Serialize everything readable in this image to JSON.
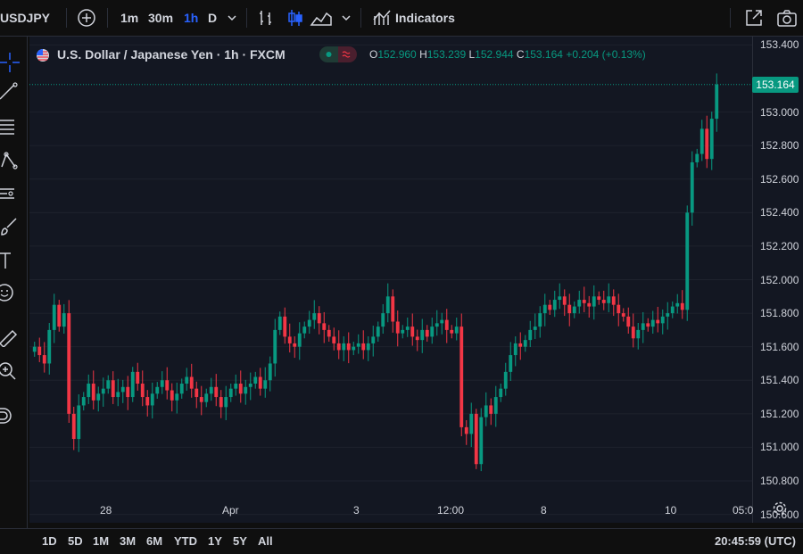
{
  "toolbar": {
    "symbol": "USDJPY",
    "intervals": [
      "1m",
      "30m",
      "1h",
      "D"
    ],
    "active_interval": "1h",
    "indicators_label": "Indicators",
    "icons": [
      "add-symbol-icon",
      "chevron-down-icon",
      "bar-replay-icon",
      "candles-icon",
      "area-chart-icon",
      "indicators-icon",
      "fullscreen-icon",
      "camera-icon"
    ]
  },
  "legend": {
    "title": "U.S. Dollar / Japanese Yen · 1h · FXCM",
    "o_label": "O",
    "o": "152.960",
    "h_label": "H",
    "h": "153.239",
    "l_label": "L",
    "l": "152.944",
    "c_label": "C",
    "c": "153.164",
    "change": "+0.204 (+0.13%)"
  },
  "price_axis": {
    "ticks": [
      "153.400",
      "153.000",
      "152.800",
      "152.600",
      "152.400",
      "152.200",
      "152.000",
      "151.800",
      "151.600",
      "151.400",
      "151.200",
      "151.000",
      "150.800",
      "150.600"
    ],
    "current_price": "153.164"
  },
  "time_axis": {
    "ticks": [
      "28",
      "Apr",
      "3",
      "12:00",
      "8",
      "10",
      "05:0"
    ]
  },
  "bottom": {
    "ranges": [
      "1D",
      "5D",
      "1M",
      "3M",
      "6M",
      "YTD",
      "1Y",
      "5Y",
      "All"
    ],
    "clock": "20:45:59 (UTC)"
  },
  "colors": {
    "up": "#089981",
    "down": "#f23645",
    "background": "#131722",
    "accent": "#2962ff"
  },
  "chart_data": {
    "type": "candlestick",
    "ylim": [
      150.55,
      153.45
    ],
    "closes": [
      151.6,
      151.55,
      151.5,
      151.7,
      151.85,
      151.72,
      151.8,
      151.2,
      151.05,
      151.25,
      151.3,
      151.38,
      151.28,
      151.32,
      151.35,
      151.4,
      151.3,
      151.33,
      151.36,
      151.3,
      151.45,
      151.38,
      151.3,
      151.25,
      151.32,
      151.36,
      151.4,
      151.34,
      151.28,
      151.32,
      151.38,
      151.42,
      151.35,
      151.3,
      151.27,
      151.32,
      151.36,
      151.3,
      151.24,
      151.3,
      151.35,
      151.38,
      151.32,
      151.36,
      151.38,
      151.42,
      151.35,
      151.4,
      151.5,
      151.7,
      151.78,
      151.66,
      151.62,
      151.6,
      151.68,
      151.72,
      151.76,
      151.8,
      151.74,
      151.7,
      151.66,
      151.62,
      151.58,
      151.62,
      151.58,
      151.6,
      151.62,
      151.58,
      151.62,
      151.66,
      151.72,
      151.8,
      151.9,
      151.75,
      151.68,
      151.7,
      151.72,
      151.66,
      151.64,
      151.7,
      151.66,
      151.72,
      151.74,
      151.76,
      151.7,
      151.68,
      151.72,
      151.12,
      151.08,
      151.2,
      150.9,
      151.18,
      151.25,
      151.2,
      151.3,
      151.35,
      151.45,
      151.55,
      151.62,
      151.6,
      151.64,
      151.7,
      151.72,
      151.8,
      151.85,
      151.82,
      151.88,
      151.9,
      151.85,
      151.8,
      151.84,
      151.88,
      151.86,
      151.84,
      151.9,
      151.88,
      151.86,
      151.9,
      151.85,
      151.8,
      151.78,
      151.72,
      151.65,
      151.7,
      151.74,
      151.72,
      151.76,
      151.74,
      151.78,
      151.8,
      151.84,
      151.86,
      151.82,
      152.4,
      152.7,
      152.75,
      152.9,
      152.72,
      152.96,
      153.164
    ]
  }
}
